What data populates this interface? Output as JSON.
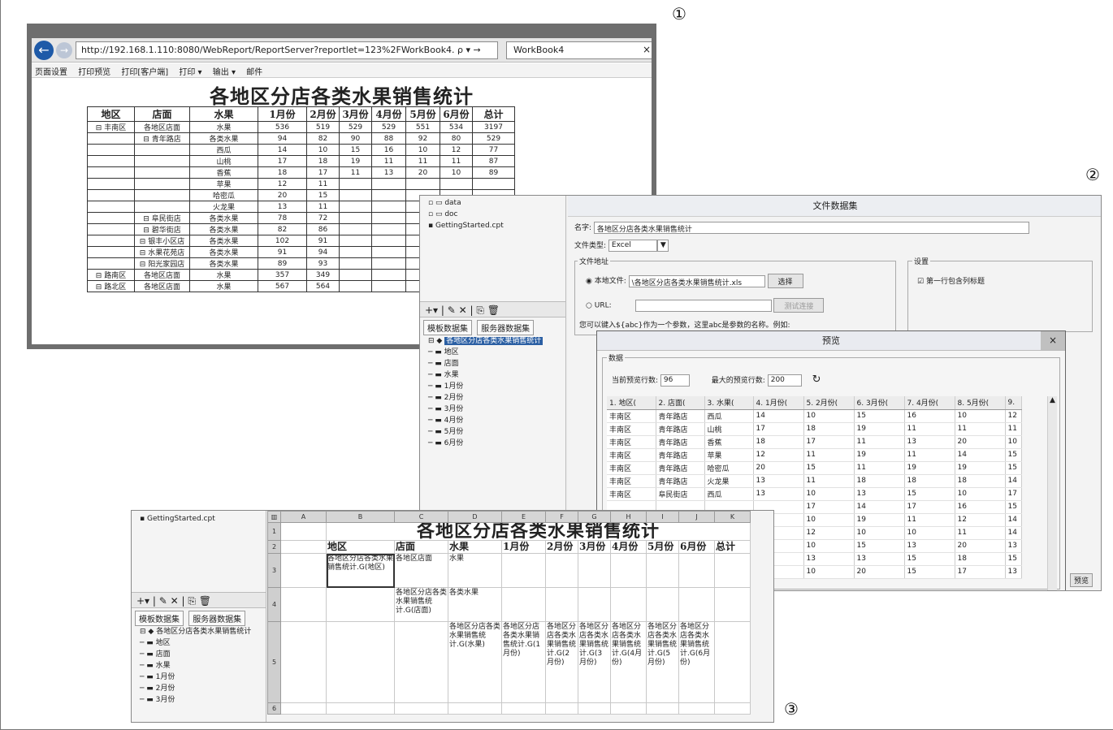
{
  "labels": {
    "n1": "①",
    "n2": "②",
    "n3": "③"
  },
  "browser": {
    "url": "http://192.168.1.110:8080/WebReport/ReportServer?reportlet=123%2FWorkBook4. ρ ▾ →",
    "tab": "WorkBook4",
    "toolbar": [
      "页面设置",
      "打印预览",
      "打印[客户端]",
      "打印 ▾",
      "输出 ▾",
      "邮件"
    ],
    "report_title": "各地区分店各类水果销售统计",
    "headers": [
      "地区",
      "店面",
      "水果",
      "1月份",
      "2月份",
      "3月份",
      "4月份",
      "5月份",
      "6月份",
      "总计"
    ],
    "rows": [
      [
        "⊟ 丰南区",
        "各地区店面",
        "水果",
        "536",
        "519",
        "529",
        "529",
        "551",
        "534",
        "3197"
      ],
      [
        "",
        "⊟ 青年路店",
        "各类水果",
        "94",
        "82",
        "90",
        "88",
        "92",
        "80",
        "529"
      ],
      [
        "",
        "",
        "西瓜",
        "14",
        "10",
        "15",
        "16",
        "10",
        "12",
        "77"
      ],
      [
        "",
        "",
        "山桃",
        "17",
        "18",
        "19",
        "11",
        "11",
        "11",
        "87"
      ],
      [
        "",
        "",
        "香蕉",
        "18",
        "17",
        "11",
        "13",
        "20",
        "10",
        "89"
      ],
      [
        "",
        "",
        "苹果",
        "12",
        "11",
        "",
        "",
        "",
        "",
        ""
      ],
      [
        "",
        "",
        "哈密瓜",
        "20",
        "15",
        "",
        "",
        "",
        "",
        ""
      ],
      [
        "",
        "",
        "火龙果",
        "13",
        "11",
        "",
        "",
        "",
        "",
        ""
      ],
      [
        "",
        "⊟ 阜民街店",
        "各类水果",
        "78",
        "72",
        "",
        "",
        "",
        "",
        ""
      ],
      [
        "",
        "⊟ 碧华街店",
        "各类水果",
        "82",
        "86",
        "",
        "",
        "",
        "",
        ""
      ],
      [
        "",
        "⊟ 银丰小区店",
        "各类水果",
        "102",
        "91",
        "",
        "",
        "",
        "",
        ""
      ],
      [
        "",
        "⊟ 水果花苑店",
        "各类水果",
        "91",
        "94",
        "",
        "",
        "",
        "",
        ""
      ],
      [
        "",
        "⊟ 阳光家园店",
        "各类水果",
        "89",
        "93",
        "",
        "",
        "",
        "",
        ""
      ],
      [
        "⊟ 路南区",
        "各地区店面",
        "水果",
        "357",
        "349",
        "",
        "",
        "",
        "",
        ""
      ],
      [
        "⊟ 路北区",
        "各地区店面",
        "水果",
        "567",
        "564",
        "",
        "",
        "",
        "",
        ""
      ]
    ]
  },
  "designer": {
    "tree_top": [
      "data",
      "doc",
      "GettingStarted.cpt"
    ],
    "tools": "+▾ | ✎ ✕ | ⎘ 🗑",
    "ds_tabs": [
      "模板数据集",
      "服务器数据集"
    ],
    "ds_root": "各地区分店各类水果销售统计",
    "ds_fields": [
      "地区",
      "店面",
      "水果",
      "1月份",
      "2月份",
      "3月份",
      "4月份",
      "5月份",
      "6月份"
    ],
    "dialog_title": "文件数据集",
    "name_label": "名字:",
    "name_value": "各地区分店各类水果销售统计",
    "type_label": "文件类型:",
    "type_value": "Excel",
    "addr_label": "文件地址",
    "local_label": "本地文件:",
    "local_value": "\\各地区分店各类水果销售统计.xls",
    "choose": "选择",
    "url_label": "URL:",
    "test_btn": "测试连接",
    "hint": "您可以键入${abc}作为一个参数，这里abc是参数的名称。例如:",
    "settings_label": "设置",
    "first_row": "第一行包含列标题",
    "preview": {
      "title": "预览",
      "close": "×",
      "group": "数据",
      "cur_label": "当前预览行数:",
      "cur_value": "96",
      "max_label": "最大的预览行数:",
      "max_value": "200",
      "refresh": "↻",
      "headers": [
        "1. 地区(",
        "2. 店面(",
        "3. 水果(",
        "4. 1月份(",
        "5. 2月份(",
        "6. 3月份(",
        "7. 4月份(",
        "8. 5月份(",
        "9."
      ],
      "rows": [
        [
          "丰南区",
          "青年路店",
          "西瓜",
          "14",
          "10",
          "15",
          "16",
          "10",
          "12"
        ],
        [
          "丰南区",
          "青年路店",
          "山桃",
          "17",
          "18",
          "19",
          "11",
          "11",
          "11"
        ],
        [
          "丰南区",
          "青年路店",
          "香蕉",
          "18",
          "17",
          "11",
          "13",
          "20",
          "10"
        ],
        [
          "丰南区",
          "青年路店",
          "苹果",
          "12",
          "11",
          "19",
          "11",
          "14",
          "15"
        ],
        [
          "丰南区",
          "青年路店",
          "哈密瓜",
          "20",
          "15",
          "11",
          "19",
          "19",
          "15"
        ],
        [
          "丰南区",
          "青年路店",
          "火龙果",
          "13",
          "11",
          "18",
          "18",
          "18",
          "14"
        ],
        [
          "丰南区",
          "阜民街店",
          "西瓜",
          "13",
          "10",
          "13",
          "15",
          "10",
          "17"
        ],
        [
          "",
          "",
          "",
          "",
          "17",
          "14",
          "17",
          "16",
          "15"
        ],
        [
          "",
          "",
          "",
          "",
          "10",
          "19",
          "11",
          "12",
          "14"
        ],
        [
          "",
          "",
          "",
          "",
          "12",
          "10",
          "10",
          "11",
          "14"
        ],
        [
          "",
          "",
          "",
          "",
          "10",
          "15",
          "13",
          "20",
          "13"
        ],
        [
          "",
          "",
          "",
          "",
          "13",
          "13",
          "15",
          "18",
          "15"
        ],
        [
          "",
          "",
          "",
          "",
          "10",
          "20",
          "15",
          "17",
          "13"
        ]
      ],
      "preview_btn": "预览"
    }
  },
  "sheet": {
    "tree_top": "GettingStarted.cpt",
    "tools": "+▾ | ✎ ✕ | ⎘ 🗑",
    "ds_tabs": [
      "模板数据集",
      "服务器数据集"
    ],
    "ds_root": "各地区分店各类水果销售统计",
    "ds_fields": [
      "地区",
      "店面",
      "水果",
      "1月份",
      "2月份",
      "3月份"
    ],
    "col_headers": [
      "A",
      "B",
      "C",
      "D",
      "E",
      "F",
      "G",
      "H",
      "I",
      "J",
      "K"
    ],
    "row_headers": [
      "1",
      "2",
      "3",
      "4",
      "5",
      "6"
    ],
    "title": "各地区分店各类水果销售统计",
    "headers": [
      "地区",
      "店面",
      "水果",
      "1月份",
      "2月份",
      "3月份",
      "4月份",
      "5月份",
      "6月份",
      "总计"
    ],
    "b3": "各地区分店各类水果销售统计.G(地区)",
    "c3": "各地区店面",
    "d3": "水果",
    "c4": "各地区分店各类水果销售统计.G(店面)",
    "d4": "各类水果",
    "d5": "各地区分店各类水果销售统计.G(水果)",
    "e5": "各地区分店各类水果销售统计.G(1月份)",
    "f5": "各地区分店各类水果销售统计.G(2月份)",
    "g5": "各地区分店各类水果销售统计.G(3月份)",
    "h5": "各地区分店各类水果销售统计.G(4月份)",
    "i5": "各地区分店各类水果销售统计.G(5月份)",
    "j5": "各地区分店各类水果销售统计.G(6月份)"
  }
}
